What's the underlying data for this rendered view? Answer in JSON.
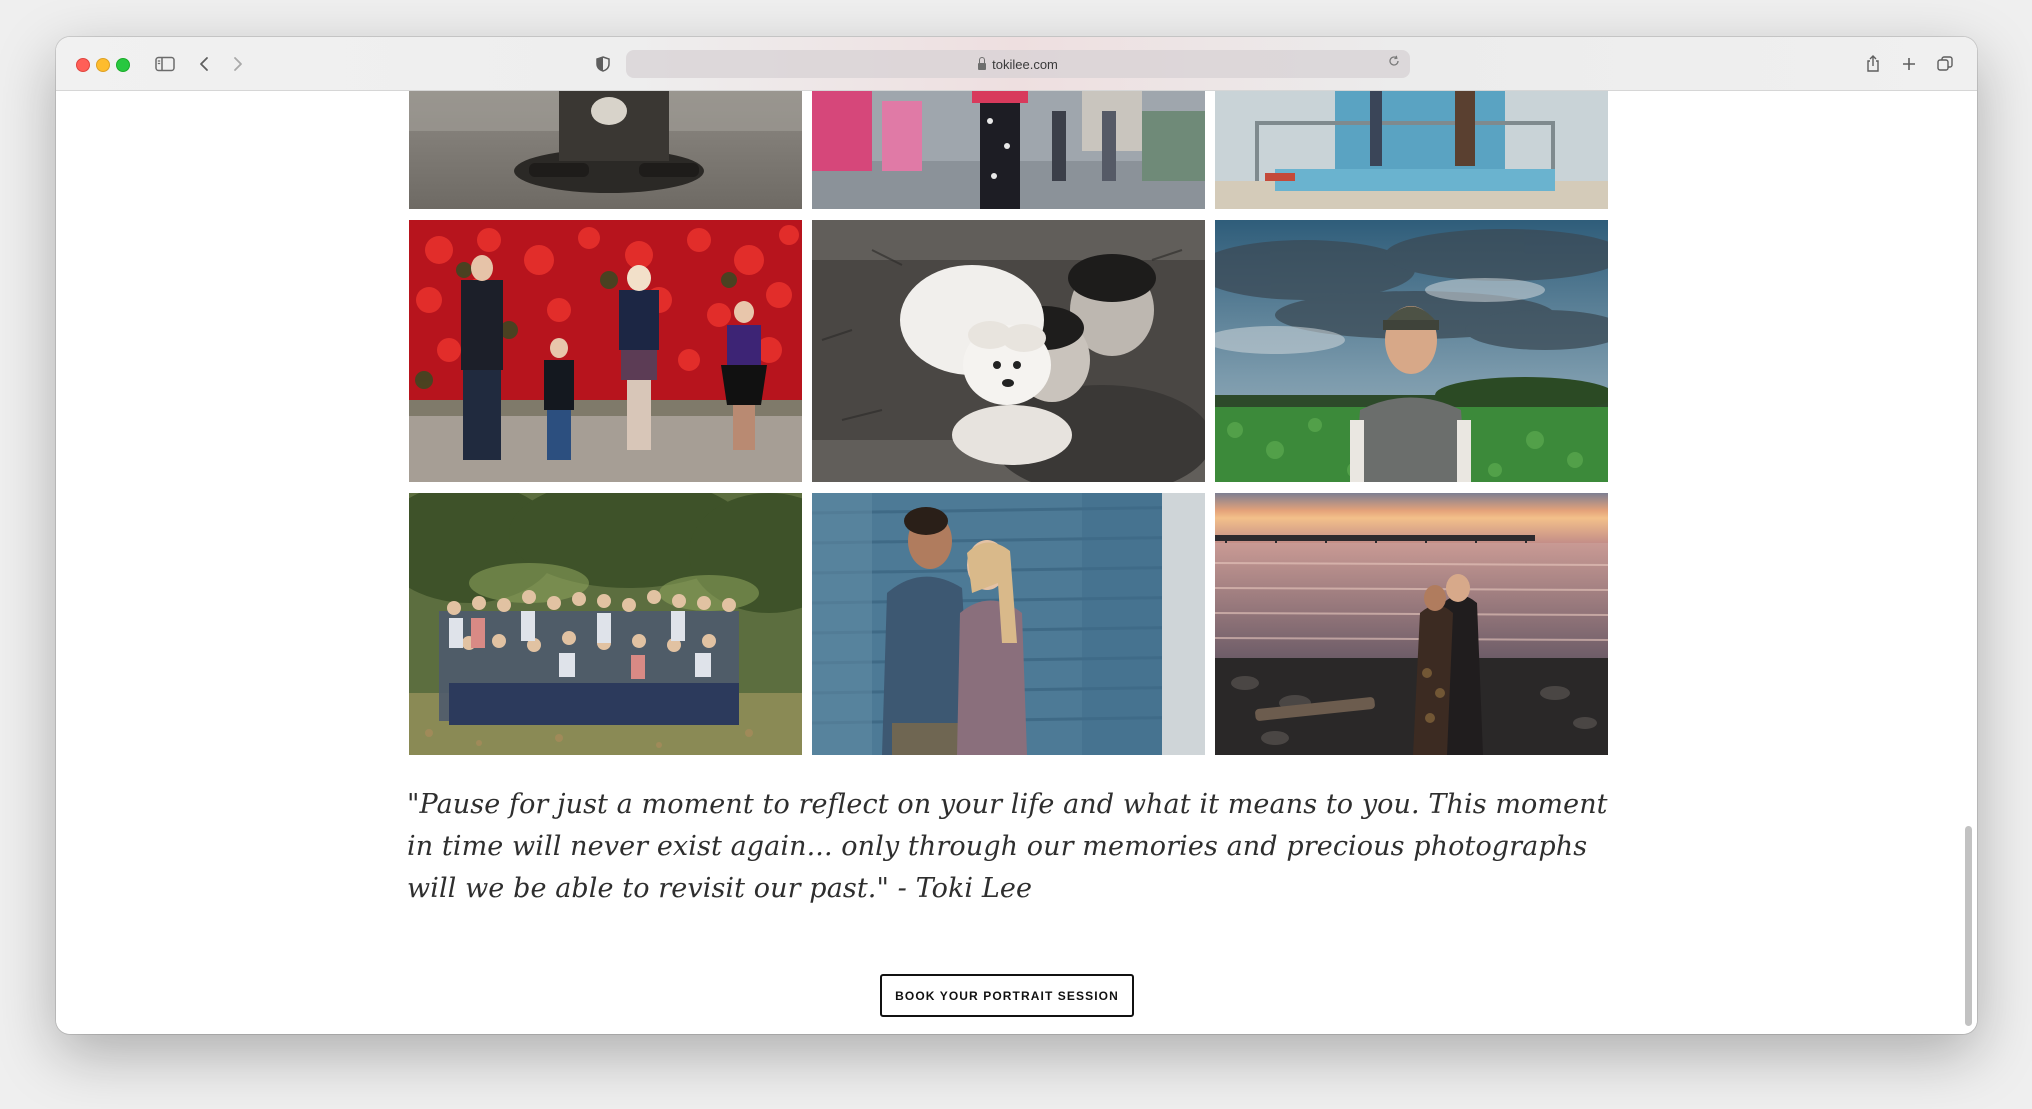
{
  "browser": {
    "url": "tokilee.com"
  },
  "gallery": {
    "photos": [
      {
        "name": "photo-guitar-couple",
        "alt": ""
      },
      {
        "name": "photo-street-walk",
        "alt": ""
      },
      {
        "name": "photo-lifeguard-tower",
        "alt": ""
      },
      {
        "name": "photo-family-red-flowers",
        "alt": ""
      },
      {
        "name": "photo-couple-with-puppy",
        "alt": ""
      },
      {
        "name": "photo-boy-in-field",
        "alt": ""
      },
      {
        "name": "photo-large-family-group",
        "alt": ""
      },
      {
        "name": "photo-couple-blue-wall",
        "alt": ""
      },
      {
        "name": "photo-couple-sunset-pier",
        "alt": ""
      }
    ]
  },
  "quote": {
    "text": "\"Pause for just a moment to reflect on your life and what it means to you.  This moment in time will never exist again... only through our memories and precious photographs will we be able to revisit our past.\"  - Toki Lee"
  },
  "cta": {
    "label": "BOOK YOUR PORTRAIT SESSION"
  }
}
